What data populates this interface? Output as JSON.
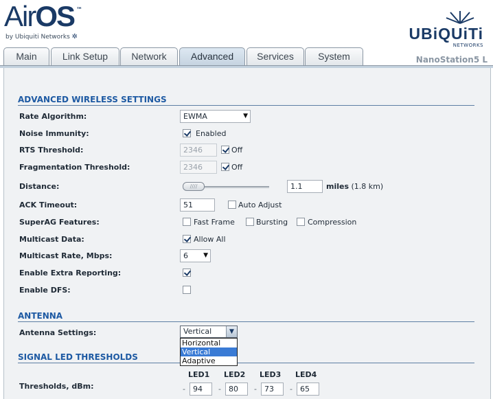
{
  "header": {
    "logo_air": "Air",
    "logo_os": "OS",
    "logo_tm": "™",
    "logo_sub": "by Ubiquiti Networks",
    "brand_word": "UBiQUiTi",
    "brand_sub": "NETWORKS",
    "device_name": "NanoStation5 L"
  },
  "tabs": [
    {
      "label": "Main"
    },
    {
      "label": "Link Setup"
    },
    {
      "label": "Network"
    },
    {
      "label": "Advanced",
      "active": true
    },
    {
      "label": "Services"
    },
    {
      "label": "System"
    }
  ],
  "sections": {
    "wireless": "ADVANCED WIRELESS SETTINGS",
    "antenna": "ANTENNA",
    "led": "SIGNAL LED THRESHOLDS"
  },
  "fields": {
    "rate_algorithm": {
      "label": "Rate Algorithm:",
      "value": "EWMA"
    },
    "noise_immunity": {
      "label": "Noise Immunity:",
      "checkbox_label": "Enabled",
      "checked": true
    },
    "rts_threshold": {
      "label": "RTS Threshold:",
      "value": "2346",
      "off_label": "Off",
      "off_checked": true
    },
    "frag_threshold": {
      "label": "Fragmentation Threshold:",
      "value": "2346",
      "off_label": "Off",
      "off_checked": true
    },
    "distance": {
      "label": "Distance:",
      "value": "1.1",
      "unit": "miles",
      "converted": "(1.8 km)"
    },
    "ack_timeout": {
      "label": "ACK Timeout:",
      "value": "51",
      "auto_label": "Auto Adjust",
      "auto_checked": false
    },
    "superag": {
      "label": "SuperAG Features:",
      "fast_frame": "Fast Frame",
      "bursting": "Bursting",
      "compression": "Compression"
    },
    "multicast_data": {
      "label": "Multicast Data:",
      "checkbox_label": "Allow All",
      "checked": true
    },
    "multicast_rate": {
      "label": "Multicast Rate, Mbps:",
      "value": "6"
    },
    "extra_reporting": {
      "label": "Enable Extra Reporting:",
      "checked": true
    },
    "dfs": {
      "label": "Enable DFS:",
      "checked": false
    },
    "antenna_settings": {
      "label": "Antenna Settings:",
      "value": "Vertical",
      "options": [
        "Horizontal",
        "Vertical",
        "Adaptive"
      ],
      "selected_index": 1
    },
    "thresholds": {
      "label": "Thresholds, dBm:",
      "leds": [
        {
          "name": "LED1",
          "value": "94"
        },
        {
          "name": "LED2",
          "value": "80"
        },
        {
          "name": "LED3",
          "value": "73"
        },
        {
          "name": "LED4",
          "value": "65"
        }
      ],
      "dash": "-"
    }
  },
  "colors": {
    "section_title": "#1e5aa3",
    "brand": "#1a3a66",
    "selected_option": "#3a7bd5"
  }
}
